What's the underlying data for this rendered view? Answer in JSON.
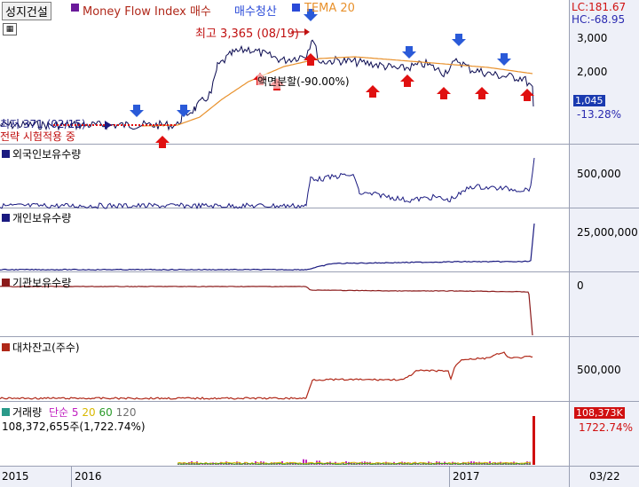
{
  "header": {
    "stock_name": "성지건설",
    "mfi_label": "Money Flow Index 매수",
    "mfi_label2": "매수청산",
    "tema_label": "TEMA 20",
    "lc": "LC:181.67",
    "hc": "HC:-68.95"
  },
  "colors": {
    "price": "#0a0a50",
    "tema": "#e8912c",
    "up_arrow": "#e01010",
    "down_arrow": "#2a5ad8",
    "foreign": "#1a1a80",
    "personal": "#1a1a80",
    "inst": "#8b1a1a",
    "lending": "#b02818"
  },
  "annotations": {
    "high": "최고 3,365 (08/19)",
    "low": "최저 371 (02/15)",
    "split": "액면분할(-90.00%)",
    "notice": "전략 시험적용 중"
  },
  "price_axis": {
    "ticks": [
      "3,000",
      "2,000"
    ],
    "current": "1,045",
    "change": "-13.28%"
  },
  "panels": {
    "foreign": {
      "title": "외국인보유수량",
      "tick": "500,000"
    },
    "personal": {
      "title": "개인보유수량",
      "tick": "25,000,000"
    },
    "inst": {
      "title": "기관보유수량",
      "tick": "0"
    },
    "lending": {
      "title": "대차잔고(주수)",
      "tick": "500,000"
    },
    "volume": {
      "title": "거래량",
      "ma_label": "단순",
      "ma": [
        "5",
        "20",
        "60",
        "120"
      ],
      "ma_colors": [
        "#c020c0",
        "#d8b800",
        "#2a9a2a",
        "#707070"
      ],
      "value_text": "108,372,655주(1,722.74%)",
      "badge": "108,373K",
      "change": "1722.74%"
    }
  },
  "x_axis": {
    "labels": [
      "2015",
      "2016",
      "2017",
      "03/22"
    ]
  },
  "chart_data": {
    "type": "line",
    "x": [
      "2015",
      "2016",
      "2017",
      "03/22"
    ],
    "series": [
      {
        "name": "TEMA 20",
        "values": []
      }
    ],
    "price_high": 3365,
    "price_low": 371,
    "price_current": 1045,
    "price_change_pct": -13.28,
    "volume_current": 108372655,
    "volume_change_pct": 1722.74
  }
}
